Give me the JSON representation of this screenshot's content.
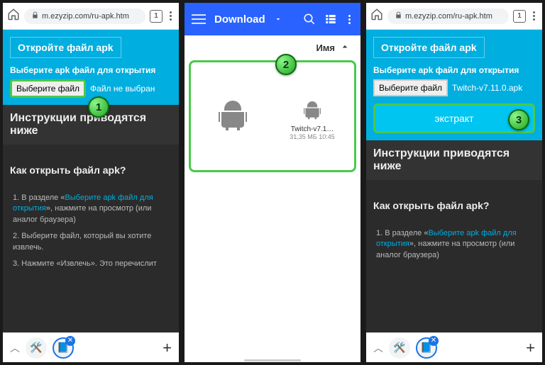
{
  "chrome": {
    "url": "m.ezyzip.com/ru-apk.htm",
    "tab_count": "1"
  },
  "page": {
    "open_title": "Откройте файл apk",
    "pick_label": "Выберите apk файл для открытия",
    "pick_button": "Выберите файл",
    "no_file": "Файл не выбран",
    "selected_file": "Twitch-v7.11.0.apk",
    "extract": "экстракт",
    "instructions_heading": "Инструкции приводятся ниже",
    "how_heading": "Как открыть файл apk?",
    "step1_a": "В разделе «",
    "step1_link": "Выберите apk файл для открытия",
    "step1_b": "», нажмите на просмотр (или аналог браузера)",
    "step2": "Выберите файл, который вы хотите извлечь.",
    "step3": "Нажмите «Извлечь». Это перечислит"
  },
  "fm": {
    "title": "Download",
    "sort_label": "Имя",
    "file_name": "Twitch-v7.1…",
    "file_meta": "31,35 МБ  10:45"
  },
  "badges": {
    "b1": "1",
    "b2": "2",
    "b3": "3"
  }
}
